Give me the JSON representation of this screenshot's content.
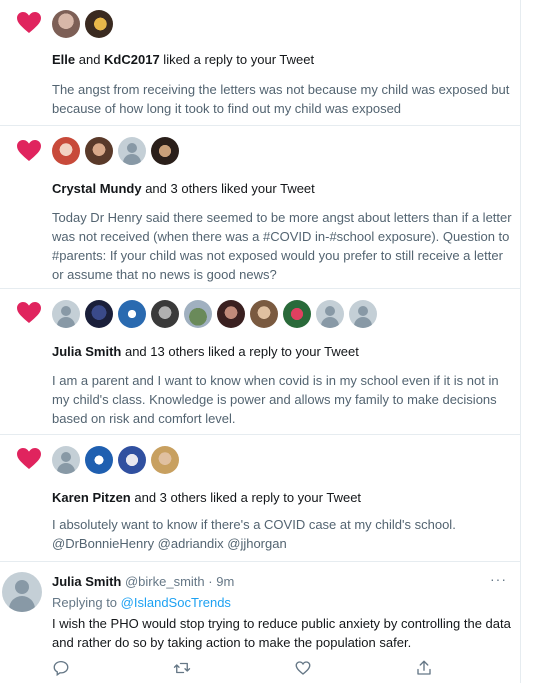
{
  "colors": {
    "heart": "#e0245e",
    "link": "#1da1f2",
    "secondary": "#657786",
    "border": "#e6ecf0"
  },
  "notifications": [
    {
      "actor": "Elle",
      "connector": " and ",
      "actor2": "KdC2017",
      "action": " liked a reply to your Tweet",
      "text": "The angst from receiving the letters was not because my child was exposed but because of how long it took to find out my child was exposed"
    },
    {
      "actor": "Crystal Mundy",
      "action": " and 3 others liked your Tweet",
      "text": "Today Dr Henry said there seemed to be more angst about letters than if a letter was not received (when there was a #COVID in-#school exposure). Question to #parents: If your child was not exposed would you prefer to still receive a letter or assume that no news is good news?"
    },
    {
      "actor": "Julia Smith",
      "action": " and 13 others liked a reply to your Tweet",
      "text": "I am a parent and I want to know when covid is in my school even if it is not in my child's class. Knowledge is power and allows my family to make decisions based on risk and comfort level."
    },
    {
      "actor": "Karen Pitzen",
      "action": " and 3 others liked a reply to your Tweet",
      "text": "I absolutely want to know if there's a COVID case at my child's school. @DrBonnieHenry @adriandix @jjhorgan"
    }
  ],
  "tweet": {
    "name": "Julia Smith",
    "handle": "@birke_smith",
    "separator": " · ",
    "time": "9m",
    "more": "···",
    "replying_prefix": "Replying to ",
    "replying_to": "@IslandSocTrends",
    "text": "I wish the PHO would stop trying to reduce public anxiety by controlling the data and rather do so by taking action to make the population safer.",
    "actions": [
      "reply-icon",
      "retweet-icon",
      "like-icon",
      "share-icon"
    ]
  }
}
